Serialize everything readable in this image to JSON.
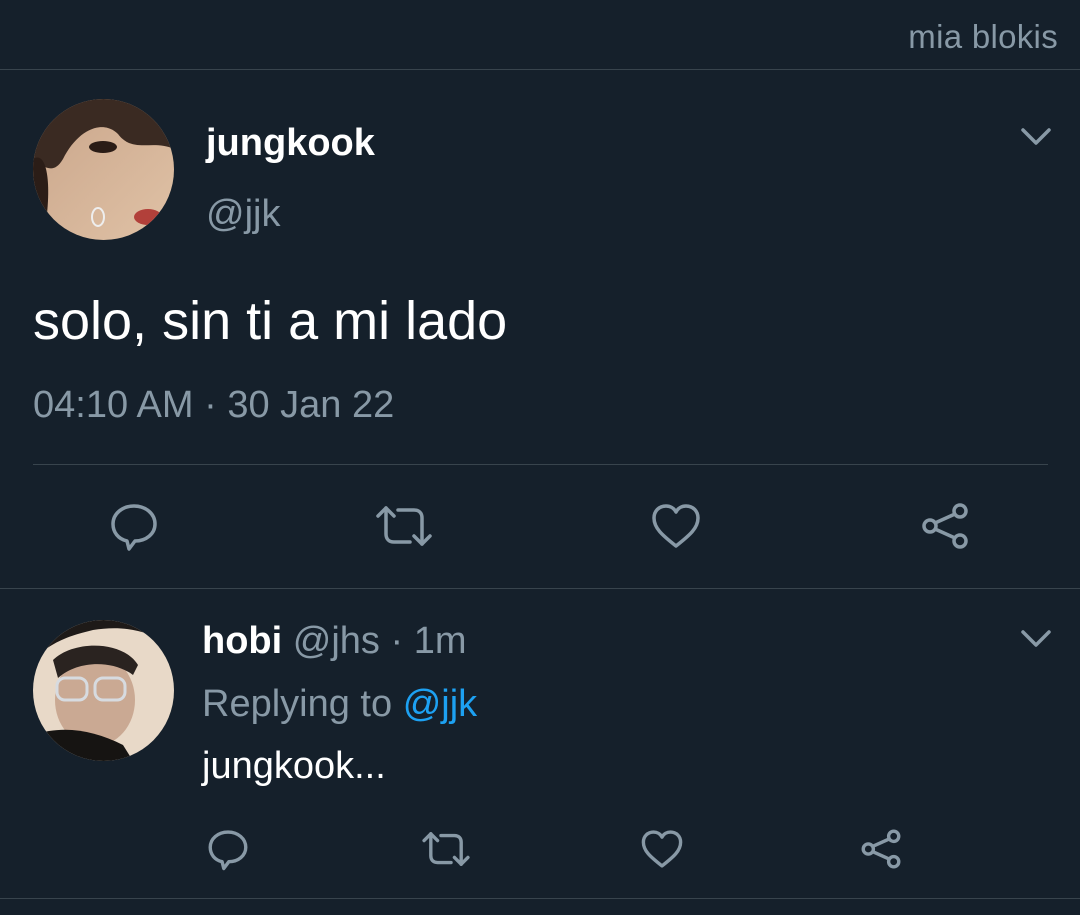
{
  "watermark": "mia blokis",
  "tweet": {
    "name": "jungkook",
    "handle": "@jjk",
    "text": "solo, sin ti a mi lado",
    "timestamp": "04:10 AM · 30 Jan 22"
  },
  "reply": {
    "name": "hobi",
    "handle": "@jhs",
    "time": "· 1m",
    "replying_label": "Replying to",
    "mention": "@jjk",
    "text": "jungkook..."
  },
  "colors": {
    "background": "#15202b",
    "secondary_text": "#8899a6",
    "mention": "#1da1f2",
    "divider": "#38444d"
  }
}
